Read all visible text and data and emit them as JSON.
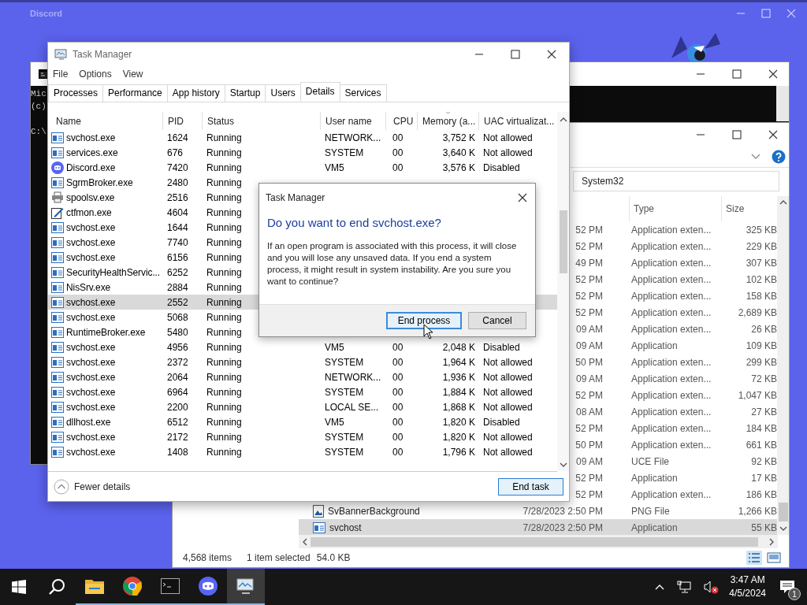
{
  "desktop_app": {
    "title": "Discord"
  },
  "console": {
    "lines": [
      "Mic",
      "(c)",
      "C:\\"
    ]
  },
  "explorer": {
    "address": "System32",
    "columns": [
      "Type",
      "Size"
    ],
    "rows": [
      {
        "date": "52 PM",
        "type": "Application exten...",
        "size": "325 KB",
        "selected": false
      },
      {
        "date": "52 PM",
        "type": "Application exten...",
        "size": "229 KB",
        "selected": false
      },
      {
        "date": "49 PM",
        "type": "Application exten...",
        "size": "307 KB",
        "selected": false
      },
      {
        "date": "52 PM",
        "type": "Application exten...",
        "size": "102 KB",
        "selected": false
      },
      {
        "date": "52 PM",
        "type": "Application exten...",
        "size": "158 KB",
        "selected": false
      },
      {
        "date": "52 PM",
        "type": "Application exten...",
        "size": "2,689 KB",
        "selected": false
      },
      {
        "date": "09 AM",
        "type": "Application exten...",
        "size": "26 KB",
        "selected": false
      },
      {
        "date": "09 AM",
        "type": "Application",
        "size": "109 KB",
        "selected": false
      },
      {
        "date": "50 PM",
        "type": "Application exten...",
        "size": "299 KB",
        "selected": false
      },
      {
        "date": "09 AM",
        "type": "Application exten...",
        "size": "72 KB",
        "selected": false
      },
      {
        "date": "52 PM",
        "type": "Application exten...",
        "size": "1,047 KB",
        "selected": false
      },
      {
        "date": "08 AM",
        "type": "Application exten...",
        "size": "27 KB",
        "selected": false
      },
      {
        "date": "52 PM",
        "type": "Application exten...",
        "size": "184 KB",
        "selected": false
      },
      {
        "date": "50 PM",
        "type": "Application exten...",
        "size": "661 KB",
        "selected": false
      },
      {
        "date": "09 AM",
        "type": "UCE File",
        "size": "92 KB",
        "selected": false
      },
      {
        "date": "52 PM",
        "type": "Application",
        "size": "17 KB",
        "selected": false
      },
      {
        "date": "52 PM",
        "type": "Application exten...",
        "size": "186 KB",
        "selected": false
      },
      {
        "name": "SvBannerBackground",
        "kind": "image",
        "date": "7/28/2023 2:50 PM",
        "type": "PNG File",
        "size": "1,266 KB",
        "selected": false
      },
      {
        "name": "svchost",
        "kind": "app",
        "date": "7/28/2023 2:50 PM",
        "type": "Application",
        "size": "55 KB",
        "selected": true
      }
    ],
    "status": {
      "count": "4,568 items",
      "selection": "1 item selected",
      "size": "54.0 KB"
    }
  },
  "task_manager": {
    "title": "Task Manager",
    "menu": [
      "File",
      "Options",
      "View"
    ],
    "tabs": [
      {
        "label": "Processes",
        "selected": false
      },
      {
        "label": "Performance",
        "selected": false
      },
      {
        "label": "App history",
        "selected": false
      },
      {
        "label": "Startup",
        "selected": false
      },
      {
        "label": "Users",
        "selected": false
      },
      {
        "label": "Details",
        "selected": true
      },
      {
        "label": "Services",
        "selected": false
      }
    ],
    "columns": [
      "Name",
      "PID",
      "Status",
      "User name",
      "CPU",
      "Memory (a...",
      "UAC virtualizat..."
    ],
    "rows": [
      {
        "kind": "service",
        "name": "svchost.exe",
        "pid": "1624",
        "status": "Running",
        "user": "NETWORK...",
        "cpu": "00",
        "memory": "3,752 K",
        "uac": "Not allowed",
        "selected": false
      },
      {
        "kind": "service",
        "name": "services.exe",
        "pid": "676",
        "status": "Running",
        "user": "SYSTEM",
        "cpu": "00",
        "memory": "3,640 K",
        "uac": "Not allowed",
        "selected": false
      },
      {
        "kind": "chat",
        "name": "Discord.exe",
        "pid": "7420",
        "status": "Running",
        "user": "VM5",
        "cpu": "00",
        "memory": "3,576 K",
        "uac": "Disabled",
        "selected": false
      },
      {
        "kind": "service",
        "name": "SgrmBroker.exe",
        "pid": "2480",
        "status": "Running",
        "selected": false
      },
      {
        "kind": "printer",
        "name": "spoolsv.exe",
        "pid": "2516",
        "status": "Running",
        "selected": false
      },
      {
        "kind": "pen",
        "name": "ctfmon.exe",
        "pid": "4604",
        "status": "Running",
        "selected": false
      },
      {
        "kind": "service",
        "name": "svchost.exe",
        "pid": "1644",
        "status": "Running",
        "selected": false
      },
      {
        "kind": "service",
        "name": "svchost.exe",
        "pid": "7740",
        "status": "Running",
        "selected": false
      },
      {
        "kind": "service",
        "name": "svchost.exe",
        "pid": "6156",
        "status": "Running",
        "selected": false
      },
      {
        "kind": "service",
        "name": "SecurityHealthServic...",
        "pid": "6252",
        "status": "Running",
        "selected": false
      },
      {
        "kind": "service",
        "name": "NisSrv.exe",
        "pid": "2884",
        "status": "Running",
        "selected": false
      },
      {
        "kind": "service",
        "name": "svchost.exe",
        "pid": "2552",
        "status": "Running",
        "selected": true
      },
      {
        "kind": "service",
        "name": "svchost.exe",
        "pid": "5068",
        "status": "Running",
        "selected": false
      },
      {
        "kind": "service",
        "name": "RuntimeBroker.exe",
        "pid": "5480",
        "status": "Running",
        "selected": false
      },
      {
        "kind": "service",
        "name": "svchost.exe",
        "pid": "4956",
        "status": "Running",
        "user": "VM5",
        "cpu": "00",
        "memory": "2,048 K",
        "uac": "Disabled",
        "selected": false
      },
      {
        "kind": "service",
        "name": "svchost.exe",
        "pid": "2372",
        "status": "Running",
        "user": "SYSTEM",
        "cpu": "00",
        "memory": "1,964 K",
        "uac": "Not allowed",
        "selected": false
      },
      {
        "kind": "service",
        "name": "svchost.exe",
        "pid": "2064",
        "status": "Running",
        "user": "NETWORK...",
        "cpu": "00",
        "memory": "1,936 K",
        "uac": "Not allowed",
        "selected": false
      },
      {
        "kind": "service",
        "name": "svchost.exe",
        "pid": "6964",
        "status": "Running",
        "user": "SYSTEM",
        "cpu": "00",
        "memory": "1,884 K",
        "uac": "Not allowed",
        "selected": false
      },
      {
        "kind": "service",
        "name": "svchost.exe",
        "pid": "2200",
        "status": "Running",
        "user": "LOCAL SE...",
        "cpu": "00",
        "memory": "1,868 K",
        "uac": "Not allowed",
        "selected": false
      },
      {
        "kind": "service",
        "name": "dllhost.exe",
        "pid": "6512",
        "status": "Running",
        "user": "VM5",
        "cpu": "00",
        "memory": "1,820 K",
        "uac": "Disabled",
        "selected": false
      },
      {
        "kind": "service",
        "name": "svchost.exe",
        "pid": "2172",
        "status": "Running",
        "user": "SYSTEM",
        "cpu": "00",
        "memory": "1,820 K",
        "uac": "Not allowed",
        "selected": false
      },
      {
        "kind": "service",
        "name": "svchost.exe",
        "pid": "1408",
        "status": "Running",
        "user": "SYSTEM",
        "cpu": "00",
        "memory": "1,796 K",
        "uac": "Not allowed",
        "selected": false
      }
    ],
    "footer": {
      "toggle": "Fewer details",
      "button": "End task"
    }
  },
  "dialog": {
    "title": "Task Manager",
    "heading": "Do you want to end svchost.exe?",
    "message": "If an open program is associated with this process, it will close and you will lose any unsaved data. If you end a system process, it might result in system instability. Are you sure you want to continue?",
    "buttons": [
      {
        "label": "End process",
        "focused": true
      },
      {
        "label": "Cancel",
        "focused": false
      }
    ]
  },
  "taskbar": {
    "apps": [
      {
        "kind": "folder",
        "active": false
      },
      {
        "kind": "browser",
        "active": false
      },
      {
        "kind": "console",
        "active": false
      },
      {
        "kind": "chat",
        "active": false
      },
      {
        "kind": "monitor",
        "active": true
      }
    ],
    "time": "3:47 AM",
    "date": "4/5/2024",
    "notifications": "1"
  }
}
